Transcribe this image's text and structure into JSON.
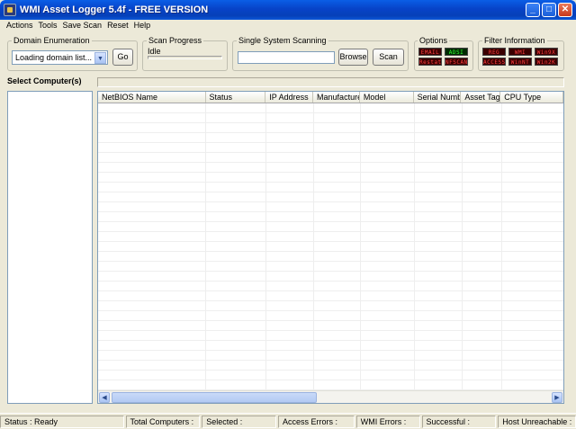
{
  "window": {
    "title": "WMI Asset Logger 5.4f - FREE VERSION",
    "buttons": {
      "minimize": "_",
      "maximize": "□",
      "close": "✕"
    }
  },
  "menu": [
    {
      "label": "Actions"
    },
    {
      "label": "Tools"
    },
    {
      "label": "Save Scan"
    },
    {
      "label": "Reset"
    },
    {
      "label": "Help"
    }
  ],
  "domain_enumeration": {
    "label": "Domain Enumeration",
    "select_value": "Loading domain list...",
    "go_label": "Go"
  },
  "scan_progress": {
    "label": "Scan Progress",
    "status": "Idle"
  },
  "single_system": {
    "label": "Single System Scanning",
    "input_value": "",
    "browse_label": "Browse",
    "scan_label": "Scan"
  },
  "options": {
    "label": "Options",
    "indicators": [
      {
        "text": "EMAIL",
        "state": "red"
      },
      {
        "text": "ADSI",
        "state": "green"
      },
      {
        "text": "Restat",
        "state": "red"
      },
      {
        "text": "NFSCAN",
        "state": "red"
      }
    ]
  },
  "filter_information": {
    "label": "Filter Information",
    "indicators": [
      {
        "text": "REG",
        "state": "red"
      },
      {
        "text": "WMI",
        "state": "red"
      },
      {
        "text": "Win9X",
        "state": "red"
      },
      {
        "text": "ACCESS",
        "state": "red"
      },
      {
        "text": "WinNT",
        "state": "red"
      },
      {
        "text": "Win2K",
        "state": "red"
      }
    ]
  },
  "computers_panel": {
    "label": "Select Computer(s)"
  },
  "grid": {
    "columns": [
      "NetBIOS Name",
      "Status",
      "IP Address",
      "Manufacturer",
      "Model",
      "Serial Number",
      "Asset Tag",
      "CPU Type"
    ]
  },
  "status_bar": [
    "Status : Ready",
    "Total Computers :",
    "Selected :",
    "Access Errors :",
    "WMI Errors :",
    "Successful :",
    "Host Unreachable :"
  ],
  "colors": {
    "accent": "#0a5ee6",
    "led_red": "#ff4040",
    "led_green": "#30ff30"
  }
}
